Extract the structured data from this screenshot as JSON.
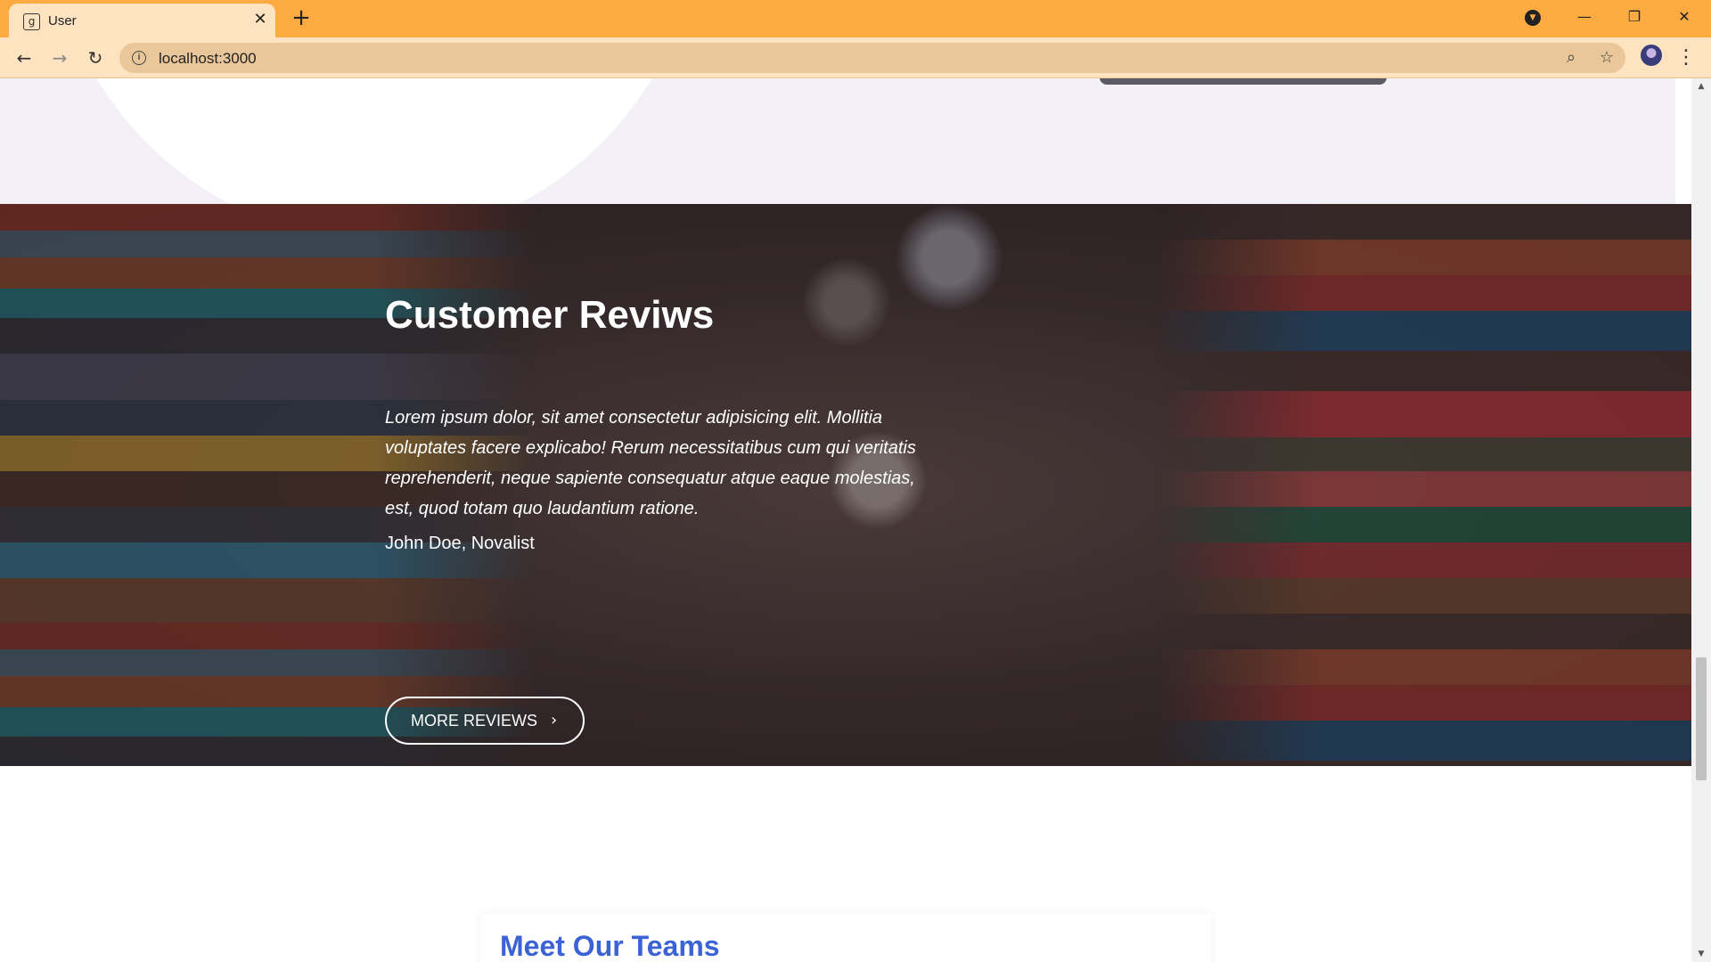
{
  "browser": {
    "tab_title": "User",
    "favicon_glyph": "g",
    "close_glyph": "✕",
    "new_tab_glyph": "+",
    "profile_menu_glyph": "▼",
    "window": {
      "minimize": "—",
      "restore": "❐",
      "close": "✕"
    },
    "nav": {
      "back": "←",
      "forward": "→",
      "reload": "↻"
    },
    "url": "localhost:3000",
    "info_glyph": "i",
    "zoom_glyph": "⌕",
    "star_glyph": "☆",
    "menu_glyph": "⋮",
    "scroll_up": "▲",
    "scroll_down": "▼",
    "accent_color": "#fbab42"
  },
  "reviews": {
    "title": "Customer Reviws",
    "quote": "Lorem ipsum dolor, sit amet consectetur adipisicing elit. Mollitia voluptates facere explicabo! Rerum necessitatibus cum qui veritatis reprehenderit, neque sapiente consequatur atque eaque molestias, est, quod totam quo laudantium ratione.",
    "author": "John Doe, Novalist",
    "button_label": "MORE REVIEWS",
    "button_chevron": "›"
  },
  "teams": {
    "title": "Meet Our Teams",
    "title_color": "#3c63d6"
  }
}
